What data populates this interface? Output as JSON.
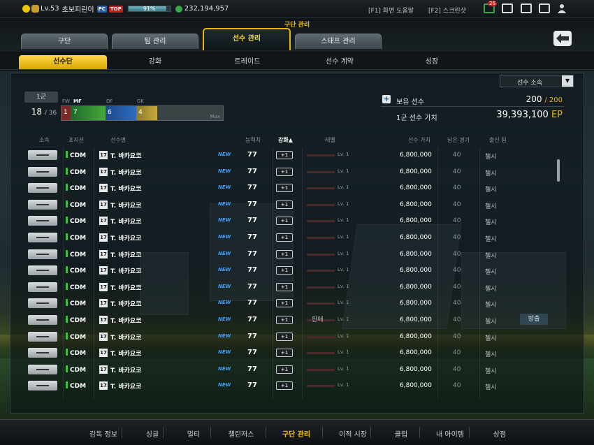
{
  "topbar": {
    "level": "Lv.53",
    "nickname": "초보피린이",
    "tag_pc": "PC",
    "tag_top": "TOP",
    "exp_percent": "91%",
    "coins": "232,194,957",
    "hotkey_help": "[F1] 화면 도움말",
    "hotkey_screenshot": "[F2] 스크린샷",
    "mail_count": "26"
  },
  "header": {
    "section_title": "구단 관리",
    "tabs": [
      "구단",
      "팀 관리",
      "선수 관리",
      "스태프 관리"
    ]
  },
  "subtabs": [
    "선수단",
    "강화",
    "트레이드",
    "선수 계약",
    "성장"
  ],
  "filter": {
    "selected": "선수 소속"
  },
  "squad": {
    "label": "1군",
    "count": "18",
    "max": "/ 36",
    "positions": {
      "labels": [
        "FW",
        "MF",
        "DF",
        "GK"
      ],
      "values": [
        "1",
        "7",
        "6",
        "4"
      ],
      "max_label": "Max"
    }
  },
  "summary": {
    "owned_label": "보유 선수",
    "owned_value": "200",
    "owned_max": "/ 200",
    "value_label": "1군 선수 가치",
    "value_amount": "39,393,100",
    "value_unit": "EP"
  },
  "table": {
    "headers": {
      "affiliation": "소속",
      "position": "포지션",
      "name": "선수명",
      "ovr": "능력치",
      "enhance": "강화▲",
      "level": "레벨",
      "value": "선수 가치",
      "games": "남은 경기",
      "club": "출신 팀"
    },
    "rows": [
      {
        "pos": "CDM",
        "season": "17",
        "name": "T. 바카요코",
        "new": "NEW",
        "ovr": "77",
        "enh": "+1",
        "lv": "Lv. 1",
        "price": "6,800,000",
        "games": "40",
        "club": "첼시"
      },
      {
        "pos": "CDM",
        "season": "17",
        "name": "T. 바카요코",
        "new": "NEW",
        "ovr": "77",
        "enh": "+1",
        "lv": "Lv. 1",
        "price": "6,800,000",
        "games": "40",
        "club": "첼시"
      },
      {
        "pos": "CDM",
        "season": "17",
        "name": "T. 바카요코",
        "new": "NEW",
        "ovr": "77",
        "enh": "+1",
        "lv": "Lv. 1",
        "price": "6,800,000",
        "games": "40",
        "club": "첼시"
      },
      {
        "pos": "CDM",
        "season": "17",
        "name": "T. 바카요코",
        "new": "NEW",
        "ovr": "77",
        "enh": "+1",
        "lv": "Lv. 1",
        "price": "6,800,000",
        "games": "40",
        "club": "첼시"
      },
      {
        "pos": "CDM",
        "season": "17",
        "name": "T. 바카요코",
        "new": "NEW",
        "ovr": "77",
        "enh": "+1",
        "lv": "Lv. 1",
        "price": "6,800,000",
        "games": "40",
        "club": "첼시"
      },
      {
        "pos": "CDM",
        "season": "17",
        "name": "T. 바카요코",
        "new": "NEW",
        "ovr": "77",
        "enh": "+1",
        "lv": "Lv. 1",
        "price": "6,800,000",
        "games": "40",
        "club": "첼시"
      },
      {
        "pos": "CDM",
        "season": "17",
        "name": "T. 바카요코",
        "new": "NEW",
        "ovr": "77",
        "enh": "+1",
        "lv": "Lv. 1",
        "price": "6,800,000",
        "games": "40",
        "club": "첼시"
      },
      {
        "pos": "CDM",
        "season": "17",
        "name": "T. 바카요코",
        "new": "NEW",
        "ovr": "77",
        "enh": "+1",
        "lv": "Lv. 1",
        "price": "6,800,000",
        "games": "40",
        "club": "첼시"
      },
      {
        "pos": "CDM",
        "season": "17",
        "name": "T. 바카요코",
        "new": "NEW",
        "ovr": "77",
        "enh": "+1",
        "lv": "Lv. 1",
        "price": "6,800,000",
        "games": "40",
        "club": "첼시"
      },
      {
        "pos": "CDM",
        "season": "17",
        "name": "T. 바카요코",
        "new": "NEW",
        "ovr": "77",
        "enh": "+1",
        "lv": "Lv. 1",
        "price": "6,800,000",
        "games": "40",
        "club": "첼시"
      },
      {
        "pos": "CDM",
        "season": "17",
        "name": "T. 바카요코",
        "new": "NEW",
        "ovr": "77",
        "enh": "+1",
        "lv": "Lv. 1",
        "price": "6,800,000",
        "games": "40",
        "club": "첼시",
        "sell": "판매",
        "release": "방출"
      },
      {
        "pos": "CDM",
        "season": "17",
        "name": "T. 바카요코",
        "new": "NEW",
        "ovr": "77",
        "enh": "+1",
        "lv": "Lv. 1",
        "price": "6,800,000",
        "games": "40",
        "club": "첼시"
      },
      {
        "pos": "CDM",
        "season": "17",
        "name": "T. 바카요코",
        "new": "NEW",
        "ovr": "77",
        "enh": "+1",
        "lv": "Lv. 1",
        "price": "6,800,000",
        "games": "40",
        "club": "첼시"
      },
      {
        "pos": "CDM",
        "season": "17",
        "name": "T. 바카요코",
        "new": "NEW",
        "ovr": "77",
        "enh": "+1",
        "lv": "Lv. 1",
        "price": "6,800,000",
        "games": "40",
        "club": "첼시"
      },
      {
        "pos": "CDM",
        "season": "17",
        "name": "T. 바카요코",
        "new": "NEW",
        "ovr": "77",
        "enh": "+1",
        "lv": "Lv. 1",
        "price": "6,800,000",
        "games": "40",
        "club": "첼시"
      }
    ]
  },
  "bottom_menu": [
    "감독 정보",
    "싱글",
    "멀티",
    "챌린저스",
    "구단 관리",
    "이적 시장",
    "클럽",
    "내 아이템",
    "상점"
  ],
  "bottom_menu_active": "구단 관리",
  "colors": {
    "accent": "#e6b800",
    "position_mark": "#3fbf3f",
    "new_tag": "#3fa0ff"
  }
}
